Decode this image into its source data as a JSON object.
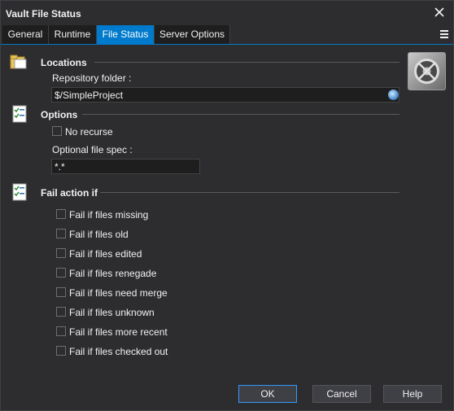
{
  "window": {
    "title": "Vault File Status"
  },
  "tabs": [
    {
      "label": "General"
    },
    {
      "label": "Runtime"
    },
    {
      "label": "File Status"
    },
    {
      "label": "Server Options"
    }
  ],
  "active_tab": "File Status",
  "locations": {
    "title": "Locations",
    "repository_label": "Repository folder :",
    "repository_value": "$/SimpleProject"
  },
  "options": {
    "title": "Options",
    "no_recurse_label": "No recurse",
    "filespec_label": "Optional file spec :",
    "filespec_value": "*.*"
  },
  "fail_action": {
    "title": "Fail action if",
    "items": [
      {
        "label": "Fail if files missing",
        "checked": false
      },
      {
        "label": "Fail if files old",
        "checked": false
      },
      {
        "label": "Fail if files edited",
        "checked": false
      },
      {
        "label": "Fail if files renegade",
        "checked": false
      },
      {
        "label": "Fail if files need merge",
        "checked": false
      },
      {
        "label": "Fail if files unknown",
        "checked": false
      },
      {
        "label": "Fail if files more recent",
        "checked": false
      },
      {
        "label": "Fail if files checked out",
        "checked": false
      }
    ]
  },
  "buttons": {
    "ok": "OK",
    "cancel": "Cancel",
    "help": "Help"
  },
  "colors": {
    "background": "#2d2d30",
    "accent": "#007acc",
    "field": "#1e1e1e"
  },
  "icons": {
    "locations": "folder-icon",
    "options": "checklist-icon",
    "fail_action": "checklist-icon",
    "logo": "vault-safe-icon"
  }
}
